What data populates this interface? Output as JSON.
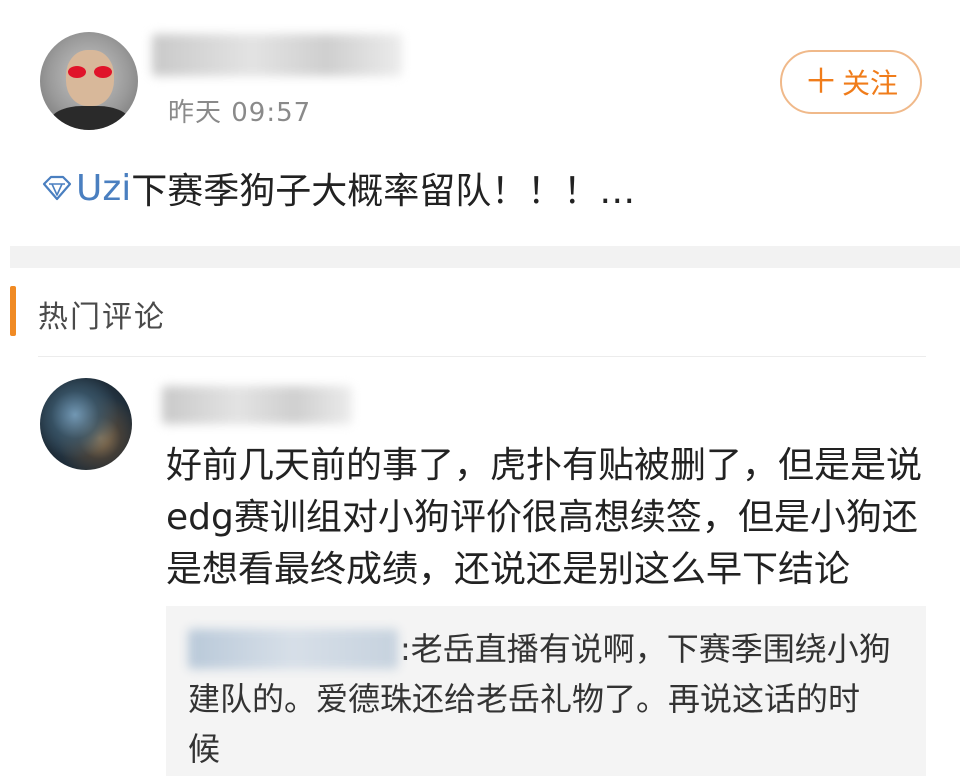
{
  "post": {
    "time": "昨天 09:57",
    "follow_label": "关注",
    "follow_plus": "＋",
    "tag": "Uzi",
    "text": "下赛季狗子大概率留队！！！…"
  },
  "comments_section": {
    "title": "热门评论"
  },
  "comment": {
    "lines": [
      "好前几天前的事了，虎扑有贴被删了，但是是说",
      "edg赛训组对小狗评价很高想续签，但是小狗还",
      "是想看最终成绩，还说还是别这么早下结论"
    ]
  },
  "reply": {
    "line1": ":老岳直播有说啊，下赛季围绕小狗",
    "line2": "建队的。爱德珠还给老岳礼物了。再说这话的时",
    "line3": "候"
  },
  "colors": {
    "accent": "#f08a24",
    "follow_text": "#f07c1a",
    "tag_blue": "#4a7fc0"
  }
}
